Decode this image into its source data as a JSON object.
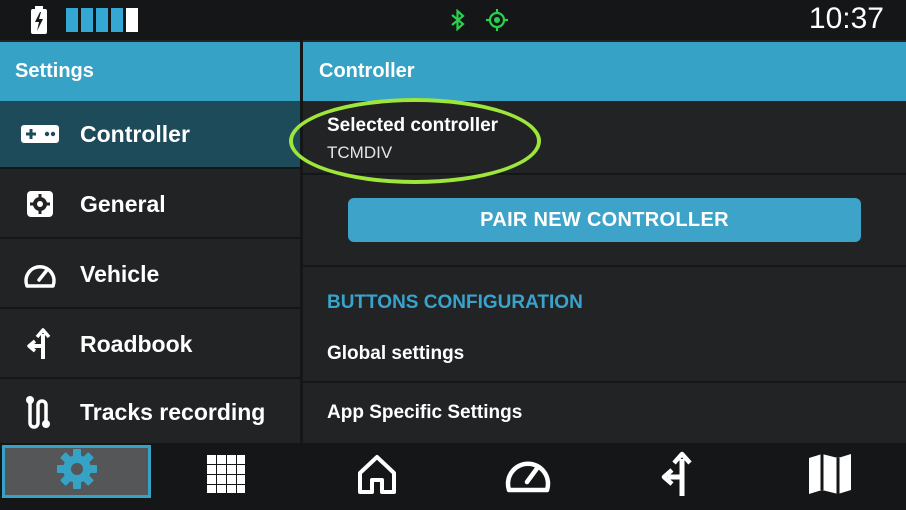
{
  "status_bar": {
    "time": "10:37",
    "battery_icon": "battery-charging-icon",
    "battery_level": 0.8,
    "bluetooth_icon": "bluetooth-icon",
    "gps_icon": "gps-fix-icon",
    "accent": "#36a2c6",
    "status_green": "#29d14f"
  },
  "sidebar": {
    "title": "Settings",
    "items": [
      {
        "label": "Controller",
        "icon": "gamepad-icon",
        "active": true
      },
      {
        "label": "General",
        "icon": "gear-icon",
        "active": false
      },
      {
        "label": "Vehicle",
        "icon": "speedometer-icon",
        "active": false
      },
      {
        "label": "Roadbook",
        "icon": "turn-arrow-icon",
        "active": false
      },
      {
        "label": "Tracks recording",
        "icon": "track-path-icon",
        "active": false
      }
    ]
  },
  "main": {
    "title": "Controller",
    "selected_controller": {
      "title": "Selected controller",
      "value": "TCMDIV"
    },
    "pair_button_label": "PAIR NEW CONTROLLER",
    "buttons_configuration": {
      "title": "BUTTONS CONFIGURATION",
      "rows": [
        {
          "label": "Global settings"
        },
        {
          "label": "App Specific Settings"
        }
      ]
    },
    "highlight_color": "#9ee63a"
  },
  "bottom_nav": [
    {
      "icon": "gear-icon",
      "active": true
    },
    {
      "icon": "apps-grid-icon",
      "active": false
    },
    {
      "icon": "home-icon",
      "active": false
    },
    {
      "icon": "speedometer-icon",
      "active": false
    },
    {
      "icon": "turn-arrow-icon",
      "active": false
    },
    {
      "icon": "map-icon",
      "active": false
    }
  ]
}
